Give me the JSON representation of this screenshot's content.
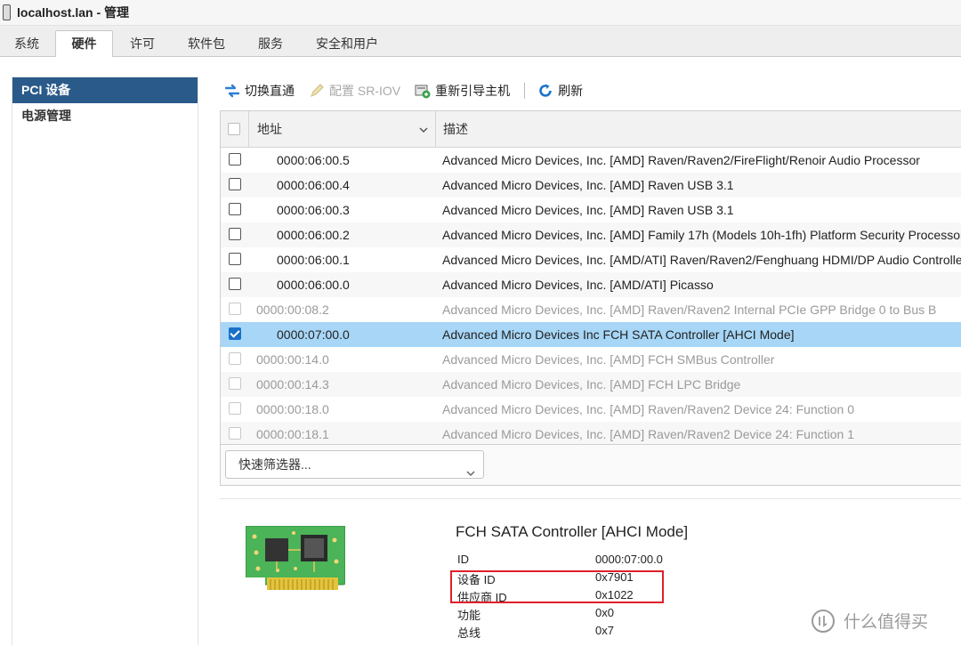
{
  "window": {
    "title": "localhost.lan - 管理"
  },
  "tabs": [
    "系统",
    "硬件",
    "许可",
    "软件包",
    "服务",
    "安全和用户"
  ],
  "active_tab": "硬件",
  "sidebar": {
    "items": [
      {
        "label": "PCI 设备",
        "active": true
      },
      {
        "label": "电源管理",
        "active": false
      }
    ]
  },
  "toolbar": {
    "toggle_passthrough": "切换直通",
    "configure_sriov": "配置 SR-IOV",
    "reboot_host": "重新引导主机",
    "refresh": "刷新"
  },
  "grid": {
    "columns": {
      "address": "地址",
      "description": "描述"
    },
    "rows": [
      {
        "address": "0000:06:00.5",
        "description": "Advanced Micro Devices, Inc. [AMD] Raven/Raven2/FireFlight/Renoir Audio Processor",
        "checked": false,
        "dim": false,
        "child": true
      },
      {
        "address": "0000:06:00.4",
        "description": "Advanced Micro Devices, Inc. [AMD] Raven USB 3.1",
        "checked": false,
        "dim": false,
        "child": true
      },
      {
        "address": "0000:06:00.3",
        "description": "Advanced Micro Devices, Inc. [AMD] Raven USB 3.1",
        "checked": false,
        "dim": false,
        "child": true
      },
      {
        "address": "0000:06:00.2",
        "description": "Advanced Micro Devices, Inc. [AMD] Family 17h (Models 10h-1fh) Platform Security Processor",
        "checked": false,
        "dim": false,
        "child": true
      },
      {
        "address": "0000:06:00.1",
        "description": "Advanced Micro Devices, Inc. [AMD/ATI] Raven/Raven2/Fenghuang HDMI/DP Audio Controller",
        "checked": false,
        "dim": false,
        "child": true
      },
      {
        "address": "0000:06:00.0",
        "description": "Advanced Micro Devices, Inc. [AMD/ATI] Picasso",
        "checked": false,
        "dim": false,
        "child": true
      },
      {
        "address": "0000:00:08.2",
        "description": "Advanced Micro Devices, Inc. [AMD] Raven/Raven2 Internal PCIe GPP Bridge 0 to Bus B",
        "checked": false,
        "dim": true,
        "child": false
      },
      {
        "address": "0000:07:00.0",
        "description": "Advanced Micro Devices Inc FCH SATA Controller [AHCI Mode]",
        "checked": true,
        "dim": false,
        "child": true,
        "selected": true
      },
      {
        "address": "0000:00:14.0",
        "description": "Advanced Micro Devices, Inc. [AMD] FCH SMBus Controller",
        "checked": false,
        "dim": true,
        "child": false
      },
      {
        "address": "0000:00:14.3",
        "description": "Advanced Micro Devices, Inc. [AMD] FCH LPC Bridge",
        "checked": false,
        "dim": true,
        "child": false
      },
      {
        "address": "0000:00:18.0",
        "description": "Advanced Micro Devices, Inc. [AMD] Raven/Raven2 Device 24: Function 0",
        "checked": false,
        "dim": true,
        "child": false
      },
      {
        "address": "0000:00:18.1",
        "description": "Advanced Micro Devices, Inc. [AMD] Raven/Raven2 Device 24: Function 1",
        "checked": false,
        "dim": true,
        "child": false
      }
    ]
  },
  "filter": {
    "label": "快速筛选器..."
  },
  "details": {
    "title": "FCH SATA Controller [AHCI Mode]",
    "props": [
      {
        "key": "ID",
        "value": "0000:07:00.0"
      },
      {
        "key": "设备 ID",
        "value": "0x7901"
      },
      {
        "key": "供应商 ID",
        "value": "0x1022"
      },
      {
        "key": "功能",
        "value": "0x0"
      },
      {
        "key": "总线",
        "value": "0x7"
      }
    ]
  },
  "watermark": {
    "text": "什么值得买"
  },
  "colors": {
    "selected_row": "#a7d6f6",
    "nav_active": "#2a5a8a",
    "highlight_box": "#e0202a",
    "checkbox_checked": "#1a6fc9"
  }
}
